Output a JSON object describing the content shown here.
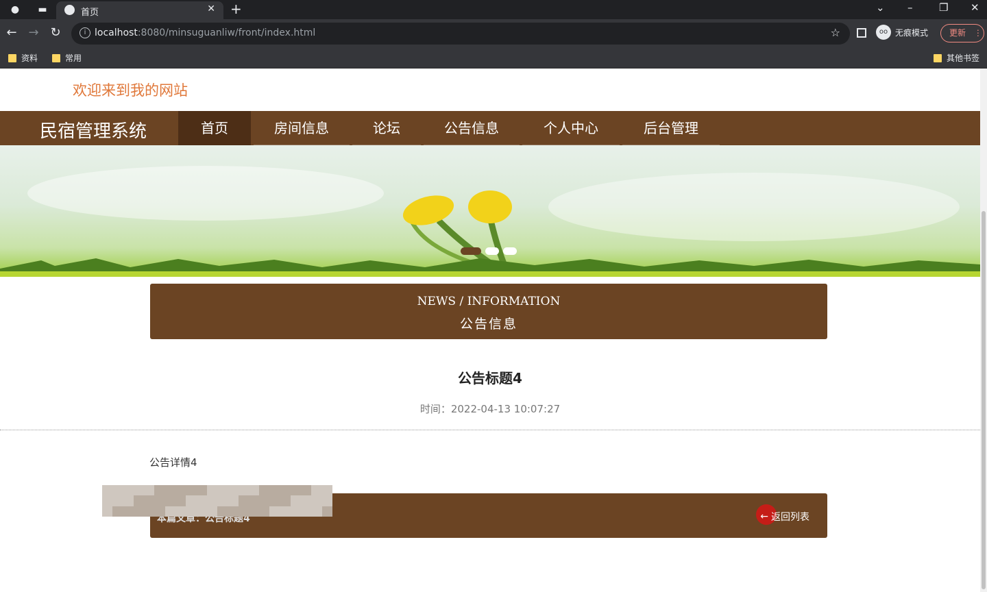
{
  "browser": {
    "tab_title": "首页",
    "url_host": "localhost",
    "url_rest": ":8080/minsuguanliw/front/index.html",
    "incognito_label": "无痕模式",
    "update_label": "更新",
    "bookmarks": [
      "资料",
      "常用"
    ],
    "other_bookmarks": "其他书签"
  },
  "site": {
    "welcome": "欢迎来到我的网站",
    "brand": "民宿管理系统",
    "nav": [
      "首页",
      "房间信息",
      "论坛",
      "公告信息",
      "个人中心",
      "后台管理"
    ],
    "active_nav_index": 0
  },
  "banner": {
    "dots": [
      {
        "active": true
      },
      {
        "active": false
      },
      {
        "active": false
      }
    ]
  },
  "section": {
    "title_en": "NEWS / INFORMATION",
    "title_zh": "公告信息"
  },
  "article": {
    "title": "公告标题4",
    "time": "时间：2022-04-13 10:07:27",
    "body": "公告详情4",
    "current_label": "本篇文章：公告标题4",
    "back_label": "返回列表"
  },
  "colors": {
    "brand_brown": "#6b4423",
    "active_brown": "#4d2e16",
    "welcome_orange": "#e0783a"
  }
}
